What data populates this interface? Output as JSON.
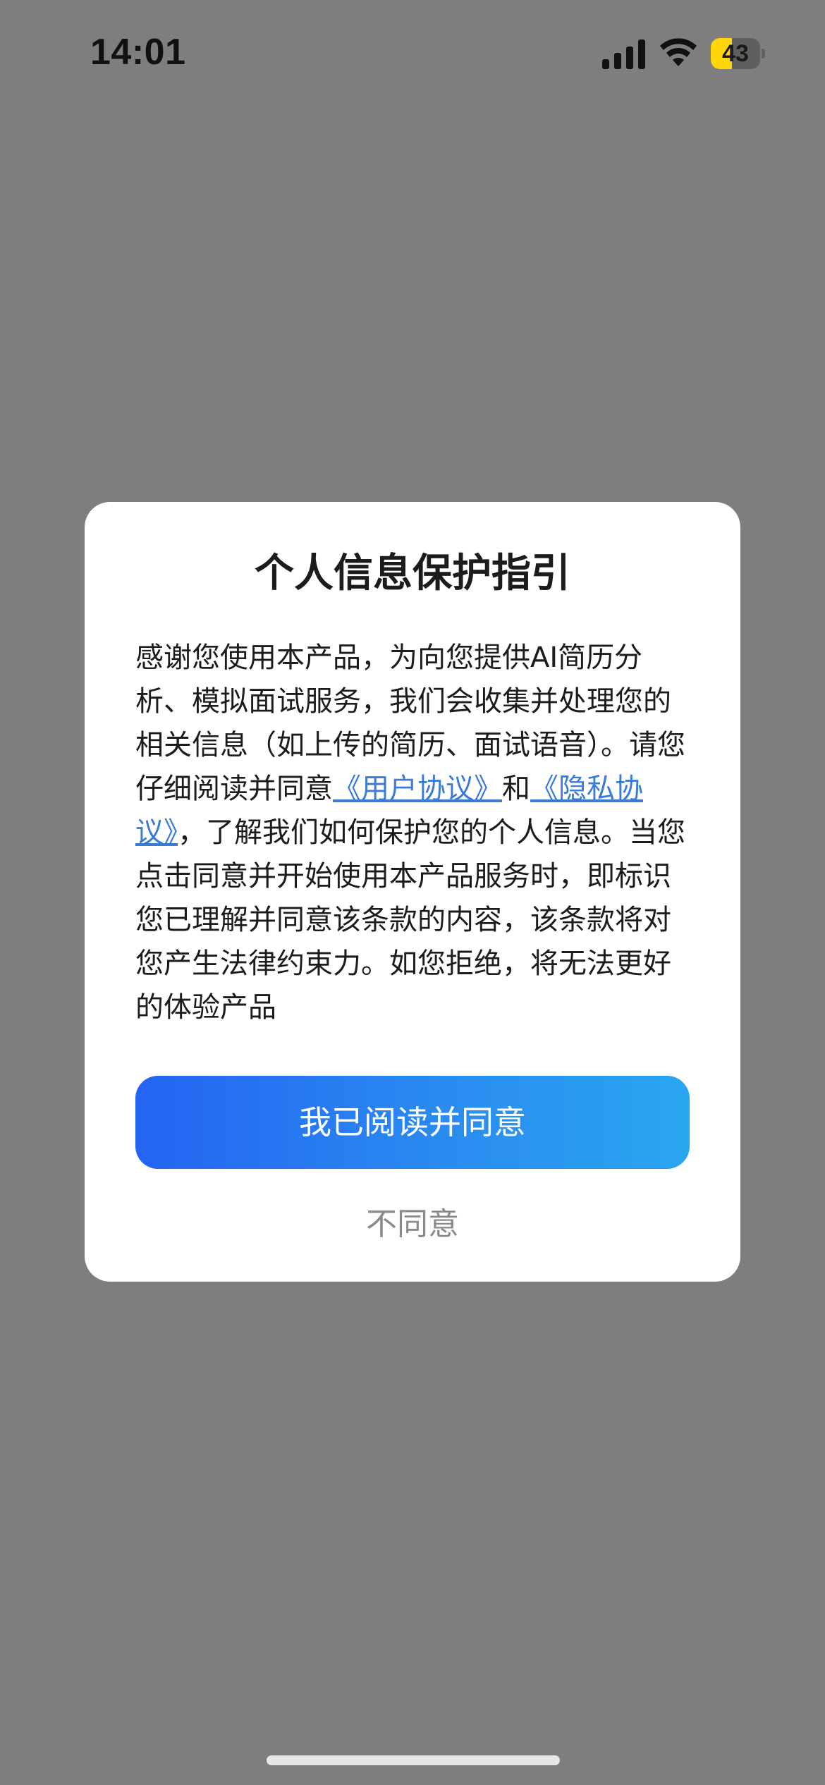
{
  "status_bar": {
    "time": "14:01",
    "signal_icon": "cellular-signal-icon",
    "wifi_icon": "wifi-icon",
    "battery_level": 43,
    "battery_text": "43",
    "battery_color": "#ffd60a"
  },
  "dialog": {
    "title": "个人信息保护指引",
    "body": {
      "part1": "感谢您使用本产品，为向您提供AI简历分析、模拟面试服务，我们会收集并处理您的相关信息（如上传的简历、面试语音）。请您仔细阅读并同意",
      "link_user_agreement": "《用户协议》",
      "conj": "和",
      "link_privacy_agreement": "《隐私协议》",
      "part2": "，了解我们如何保护您的个人信息。当您点击同意并开始使用本产品服务时，即标识您已理解并同意该条款的内容，该条款将对您产生法律约束力。如您拒绝，将无法更好的体验产品"
    },
    "agree_label": "我已阅读并同意",
    "disagree_label": "不同意"
  },
  "colors": {
    "overlay": "#7e7e7e",
    "link": "#3a7bd5",
    "button_gradient_start": "#2464f2",
    "button_gradient_end": "#2aa6f0",
    "secondary_text": "#8a8a8e"
  }
}
